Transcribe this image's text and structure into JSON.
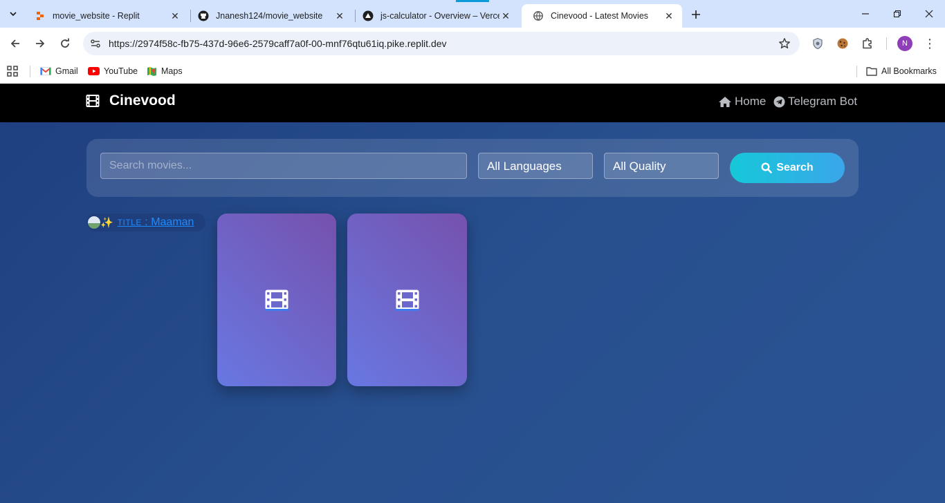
{
  "browser": {
    "tabs": [
      {
        "title": "movie_website - Replit",
        "icon": "replit-icon",
        "active": false
      },
      {
        "title": "Jnanesh124/movie_website",
        "icon": "github-icon",
        "active": false
      },
      {
        "title": "js-calculator - Overview – Vercel",
        "icon": "vercel-icon",
        "active": false
      },
      {
        "title": "Cinevood - Latest Movies",
        "icon": "globe-icon",
        "active": true
      }
    ],
    "url": "https://2974f58c-fb75-437d-96e6-2579caff7a0f-00-mnf76qtu61iq.pike.replit.dev",
    "profile_initial": "N",
    "bookmarks": [
      {
        "label": "Gmail",
        "icon": "gmail-icon"
      },
      {
        "label": "YouTube",
        "icon": "youtube-icon"
      },
      {
        "label": "Maps",
        "icon": "maps-icon"
      }
    ],
    "all_bookmarks_label": "All Bookmarks"
  },
  "site": {
    "brand": "Cinevood",
    "nav": [
      {
        "label": "Home",
        "icon": "home-icon"
      },
      {
        "label": "Telegram Bot",
        "icon": "telegram-icon"
      }
    ],
    "search": {
      "placeholder": "Search movies...",
      "language_selected": "All Languages",
      "quality_selected": "All Quality",
      "button_label": "Search"
    },
    "movie_card": {
      "title_prefix": "TITLE",
      "title_separator": " : ",
      "title": "Maaman"
    },
    "posters": [
      {
        "icon": "film-icon"
      },
      {
        "icon": "film-icon"
      }
    ]
  },
  "colors": {
    "header_bg": "#000000",
    "page_bg": "#25498c",
    "search_button": "#16c8d8",
    "poster_gradient_start": "#6878e2",
    "poster_gradient_end": "#7651ad",
    "link": "#1e8bff"
  }
}
